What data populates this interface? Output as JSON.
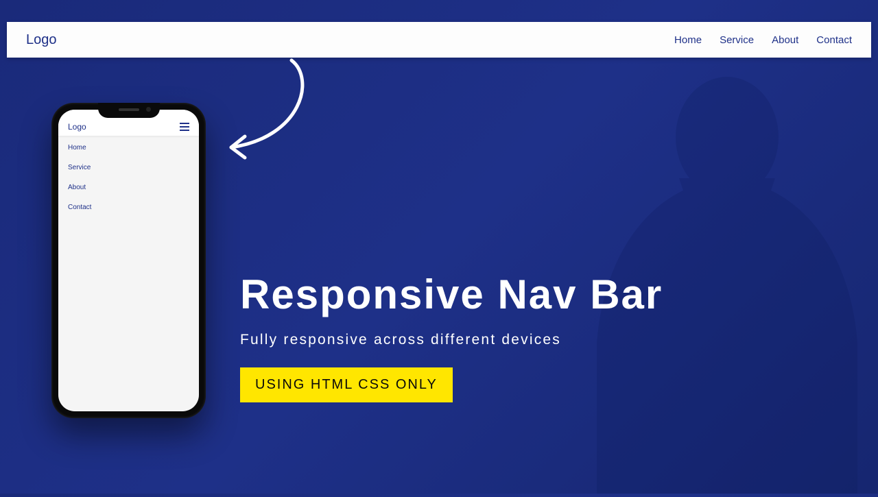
{
  "navbar": {
    "logo": "Logo",
    "links": [
      {
        "label": "Home"
      },
      {
        "label": "Service"
      },
      {
        "label": "About"
      },
      {
        "label": "Contact"
      }
    ]
  },
  "mobile": {
    "logo": "Logo",
    "links": [
      {
        "label": "Home"
      },
      {
        "label": "Service"
      },
      {
        "label": "About"
      },
      {
        "label": "Contact"
      }
    ]
  },
  "hero": {
    "title": "Responsive Nav Bar",
    "subtitle": "Fully responsive across different devices",
    "badge": "USING HTML CSS ONLY"
  },
  "colors": {
    "accent": "#1e3088",
    "badge_bg": "#ffe600"
  }
}
